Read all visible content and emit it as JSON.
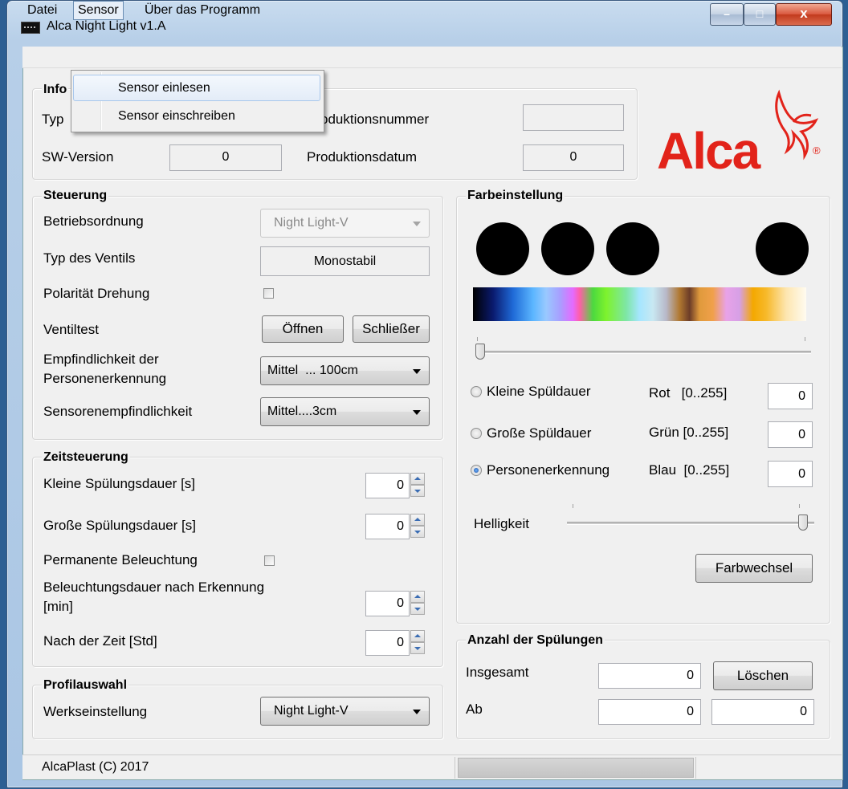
{
  "window": {
    "title": "Alca Night Light  v1.A",
    "minimize": "–",
    "maximize": "□",
    "close": "x"
  },
  "menu": {
    "file": "Datei",
    "sensor": "Sensor",
    "about": "Über das Programm",
    "sensor_items": [
      "Sensor einlesen",
      "Sensor einschreiben"
    ]
  },
  "info": {
    "title": "Info",
    "type_label": "Typ",
    "production_number_label": "Produktionsnummer",
    "production_number_value": "",
    "sw_version_label": "SW-Version",
    "sw_version_value": "0",
    "production_date_label": "Produktionsdatum",
    "production_date_value": "0"
  },
  "logo": {
    "text": "Alca",
    "registered": "®"
  },
  "steuerung": {
    "title": "Steuerung",
    "operating_mode_label": "Betriebsordnung",
    "operating_mode_value": "Night Light-V",
    "valve_type_label": "Typ des Ventils",
    "valve_type_value": "Monostabil",
    "polarity_label": "Polarität Drehung",
    "valve_test_label": "Ventiltest",
    "open_button": "Öffnen",
    "close_button": "Schließer",
    "person_sensitivity_label_1": "Empfindlichkeit der",
    "person_sensitivity_label_2": "Personenerkennung",
    "person_sensitivity_value": "Mittel  ... 100cm",
    "sensor_sensitivity_label": "Sensorenempfindlichkeit",
    "sensor_sensitivity_value": "Mittel....3cm"
  },
  "zeitsteuerung": {
    "title": "Zeitsteuerung",
    "small_flush_label": "Kleine Spülungsdauer [s]",
    "small_flush_value": "0",
    "large_flush_label": "Große Spülungsdauer [s]",
    "large_flush_value": "0",
    "permanent_light_label": "Permanente Beleuchtung",
    "light_duration_label_1": "Beleuchtungsdauer nach Erkennung",
    "light_duration_label_2": "[min]",
    "light_duration_value": "0",
    "after_time_label": "Nach der Zeit  [Std]",
    "after_time_value": "0"
  },
  "profil": {
    "title": "Profilauswahl",
    "factory_label": "Werkseinstellung",
    "profile_value": "Night Light-V"
  },
  "farbe": {
    "title": "Farbeinstellung",
    "swatch_colors": [
      "#000000",
      "#000000",
      "#000000",
      "#000000"
    ],
    "radio_small": "Kleine Spüldauer",
    "radio_large": "Große Spüldauer",
    "radio_person": "Personenerkennung",
    "red_label": "Rot   [0..255]",
    "red_value": "0",
    "green_label": "Grün [0..255]",
    "green_value": "0",
    "blue_label": "Blau  [0..255]",
    "blue_value": "0",
    "brightness_label": "Helligkeit",
    "color_change_button": "Farbwechsel",
    "brightness_level": 1.0,
    "color_slider_level": 0.0
  },
  "spuelungen": {
    "title": "Anzahl der Spülungen",
    "total_label": "Insgesamt",
    "total_value": "0",
    "delete_button": "Löschen",
    "from_label": "Ab",
    "from_value": "0",
    "from_value_2": "0"
  },
  "status": {
    "copyright": "AlcaPlast  (C) 2017"
  }
}
